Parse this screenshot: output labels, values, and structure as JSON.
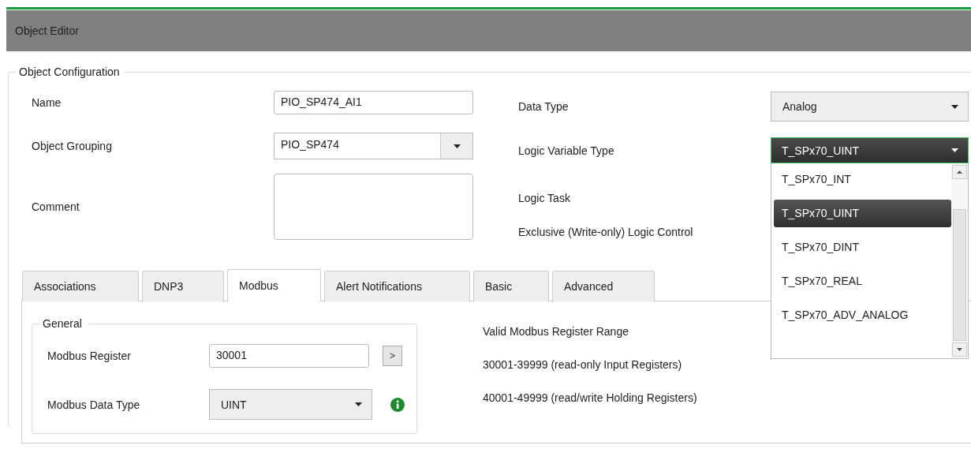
{
  "header": {
    "title": "Object Editor"
  },
  "object_configuration": {
    "title": "Object Configuration",
    "name": {
      "label": "Name",
      "value": "PIO_SP474_AI1"
    },
    "object_grouping": {
      "label": "Object Grouping",
      "value": "PIO_SP474"
    },
    "comment": {
      "label": "Comment"
    },
    "data_type": {
      "label": "Data Type",
      "value": "Analog"
    },
    "logic_variable_type": {
      "label": "Logic Variable Type",
      "value": "T_SPx70_UINT",
      "expanded": true,
      "options": [
        {
          "label": "T_SPx70_INT",
          "selected": false
        },
        {
          "label": "T_SPx70_UINT",
          "selected": true
        },
        {
          "label": "T_SPx70_DINT",
          "selected": false
        },
        {
          "label": "T_SPx70_REAL",
          "selected": false
        },
        {
          "label": "T_SPx70_ADV_ANALOG",
          "selected": false
        }
      ]
    },
    "logic_task": {
      "label": "Logic Task"
    },
    "exclusive_logic_control": {
      "label": "Exclusive (Write-only) Logic Control"
    }
  },
  "tabs": [
    {
      "label": "Associations",
      "selected": false
    },
    {
      "label": "DNP3",
      "selected": false
    },
    {
      "label": "Modbus",
      "selected": true
    },
    {
      "label": "Alert Notifications",
      "selected": false
    },
    {
      "label": "Basic",
      "selected": false
    },
    {
      "label": "Advanced",
      "selected": false
    }
  ],
  "modbus": {
    "general": {
      "title": "General",
      "register": {
        "label": "Modbus Register",
        "value": "30001",
        "button": ">"
      },
      "data_type": {
        "label": "Modbus Data Type",
        "value": "UINT"
      }
    },
    "range": {
      "title": "Valid Modbus Register Range",
      "lines": [
        "30001-39999 (read-only Input Registers)",
        "40001-49999 (read/write Holding Registers)"
      ]
    }
  }
}
